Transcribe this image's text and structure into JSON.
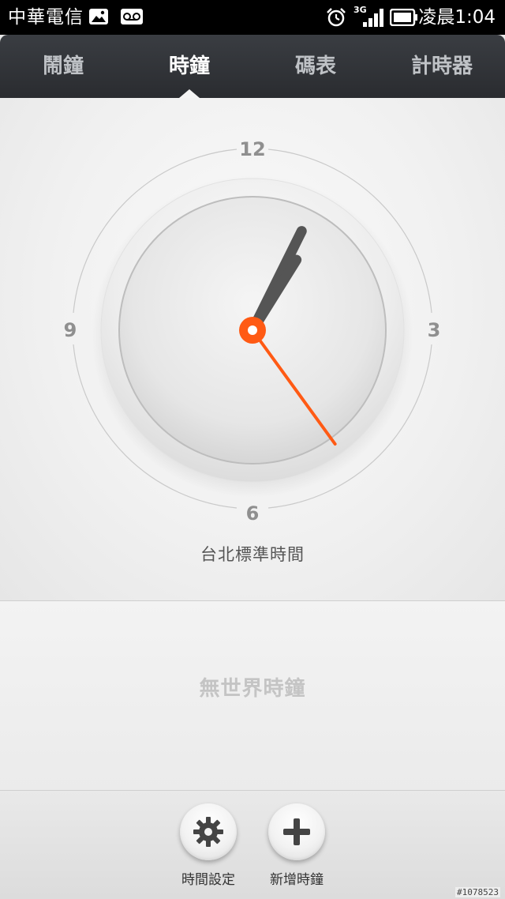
{
  "status_bar": {
    "carrier": "中華電信",
    "network": "3G",
    "time": "凌晨1:04",
    "icons": [
      "image-icon",
      "voicemail-icon",
      "alarm-icon",
      "signal-icon",
      "battery-icon"
    ]
  },
  "tabs": [
    {
      "label": "鬧鐘",
      "active": false
    },
    {
      "label": "時鐘",
      "active": true
    },
    {
      "label": "碼表",
      "active": false
    },
    {
      "label": "計時器",
      "active": false
    }
  ],
  "clock": {
    "markers": {
      "twelve": "12",
      "three": "3",
      "six": "6",
      "nine": "9"
    },
    "time": {
      "hour": 1,
      "minute": 4,
      "second": 24
    },
    "timezone_label": "台北標準時間",
    "second_hand_color": "#ff5a14"
  },
  "world_clocks": {
    "empty_label": "無世界時鐘"
  },
  "actions": [
    {
      "label": "時間設定",
      "icon": "gear-icon"
    },
    {
      "label": "新增時鐘",
      "icon": "plus-icon"
    }
  ],
  "watermark": "#1078523"
}
